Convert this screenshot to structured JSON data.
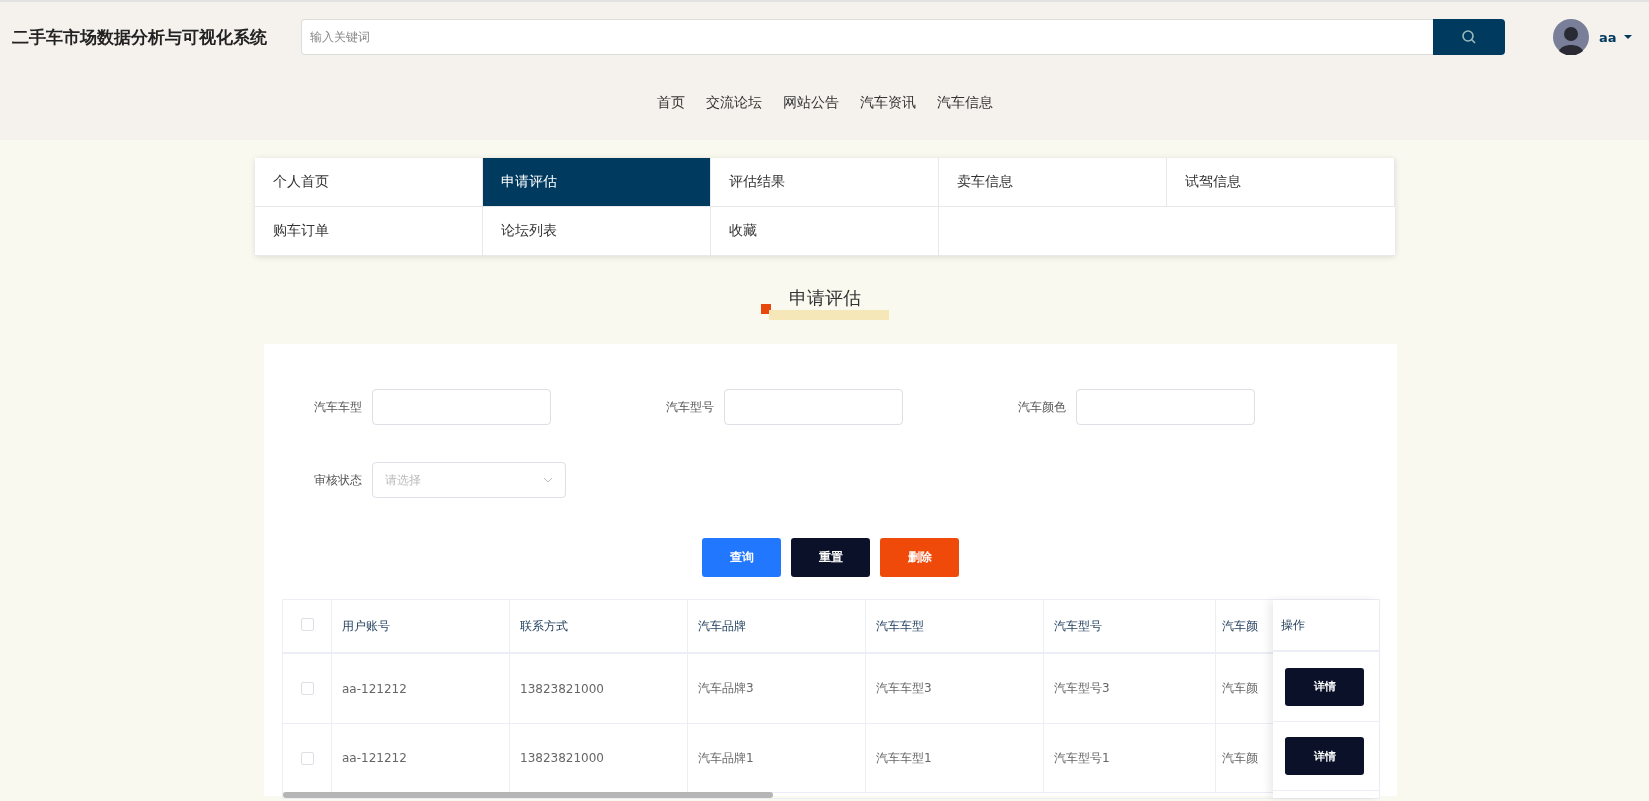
{
  "header": {
    "title": "二手车市场数据分析与可视化系统",
    "search": {
      "placeholder": "输入关键词"
    },
    "user": {
      "name": "aa"
    }
  },
  "nav": [
    "首页",
    "交流论坛",
    "网站公告",
    "汽车资讯",
    "汽车信息"
  ],
  "menu": [
    {
      "label": "个人首页",
      "selected": false
    },
    {
      "label": "申请评估",
      "selected": true
    },
    {
      "label": "评估结果",
      "selected": false
    },
    {
      "label": "卖车信息",
      "selected": false
    },
    {
      "label": "试驾信息",
      "selected": false
    },
    {
      "label": "购车订单",
      "selected": false
    },
    {
      "label": "论坛列表",
      "selected": false
    },
    {
      "label": "收藏",
      "selected": false
    }
  ],
  "section_title": "申请评估",
  "filters": [
    {
      "label": "汽车车型",
      "kind": "input"
    },
    {
      "label": "汽车型号",
      "kind": "input"
    },
    {
      "label": "汽车颜色",
      "kind": "input"
    },
    {
      "label": "审核状态",
      "kind": "select",
      "placeholder": "请选择"
    }
  ],
  "buttons": [
    {
      "label": "查询",
      "kind": "primary"
    },
    {
      "label": "重置",
      "kind": "dark"
    },
    {
      "label": "删除",
      "kind": "danger"
    }
  ],
  "table": {
    "header_checked": false,
    "columns": [
      "用户账号",
      "联系方式",
      "汽车品牌",
      "汽车车型",
      "汽车型号",
      "汽车颜"
    ],
    "action_column": "操作",
    "rows": [
      {
        "checked": false,
        "cells": [
          "aa-121212",
          "13823821000",
          "汽车品牌3",
          "汽车车型3",
          "汽车型号3",
          "汽车颜"
        ],
        "action": "详情"
      },
      {
        "checked": false,
        "cells": [
          "aa-121212",
          "13823821000",
          "汽车品牌1",
          "汽车车型1",
          "汽车型号1",
          "汽车颜"
        ],
        "action": "详情"
      }
    ]
  }
}
